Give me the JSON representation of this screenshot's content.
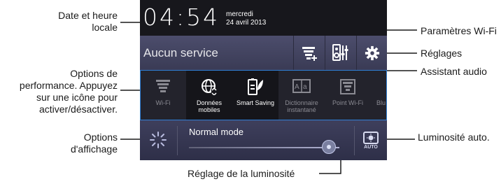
{
  "panel": {
    "clock": "04:54",
    "day": "mercredi",
    "date": "24 avril 2013",
    "service_status": "Aucun service",
    "toggles": [
      {
        "label": "Wi-Fi",
        "state": "off"
      },
      {
        "label": "Données mobiles",
        "state": "on"
      },
      {
        "label": "Smart Saving",
        "state": "on"
      },
      {
        "label": "Dictionnaire instantané",
        "state": "off"
      },
      {
        "label": "Point Wi-Fi",
        "state": "off"
      },
      {
        "label": "Blu",
        "state": "off"
      }
    ],
    "brightness_mode": "Normal mode",
    "brightness_level": 0.93,
    "auto_label": "AUTO"
  },
  "annotations": {
    "date_time": [
      "Date et heure",
      "locale"
    ],
    "performance": [
      "Options de",
      "performance. Appuyez",
      "sur une icône pour",
      "activer/désactiver."
    ],
    "display": [
      "Options",
      "d'affichage"
    ],
    "wifi_settings": "Paramètres Wi-Fi",
    "settings": "Réglages",
    "audio": "Assistant audio",
    "auto_brightness": "Luminosité auto.",
    "brightness": "Réglage de la luminosité"
  },
  "icons": {
    "wifi_settings": "wifi-settings-icon",
    "audio": "audio-wizard-icon",
    "settings": "gear-icon",
    "display": "display-options-icon",
    "auto_brightness": "auto-brightness-icon"
  },
  "colors": {
    "accent": "#2f7fd6",
    "panel_dark": "#17171c",
    "panel_mid": "#4c4d6c"
  }
}
